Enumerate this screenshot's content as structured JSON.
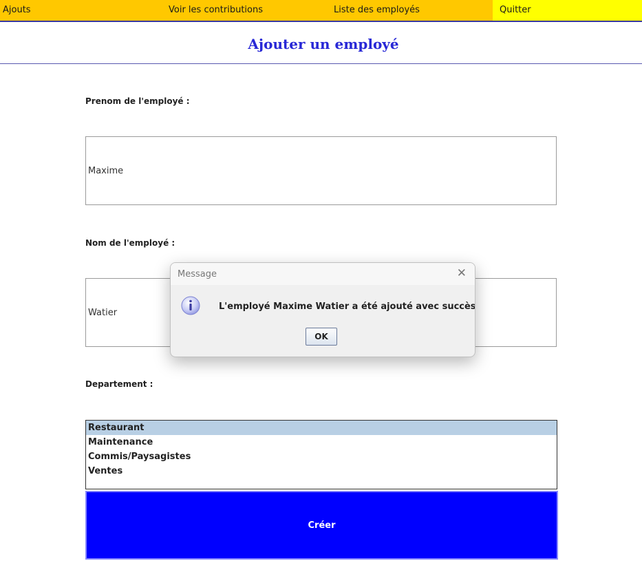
{
  "menu": {
    "items": [
      "Ajouts",
      "Voir les contributions",
      "Liste des employés",
      "Quitter"
    ]
  },
  "page": {
    "title": "Ajouter un employé"
  },
  "form": {
    "first_name_label": "Prenom de l'employé :",
    "first_name_value": "Maxime",
    "last_name_label": "Nom de l'employé :",
    "last_name_value": "Watier",
    "department_label": "Departement :",
    "departments": [
      "Restaurant",
      "Maintenance",
      "Commis/Paysagistes",
      "Ventes"
    ],
    "selected_department": "Restaurant",
    "create_label": "Créer"
  },
  "dialog": {
    "title": "Message",
    "message": "L'employé Maxime Watier a été ajouté avec succès",
    "ok_label": "OK",
    "icon": "info-icon"
  },
  "colors": {
    "menu_bg": "#ffc800",
    "quit_bg": "#ffff00",
    "title": "#2828d6",
    "create_button": "#0000ff",
    "selected_row": "#b8cfe4"
  }
}
